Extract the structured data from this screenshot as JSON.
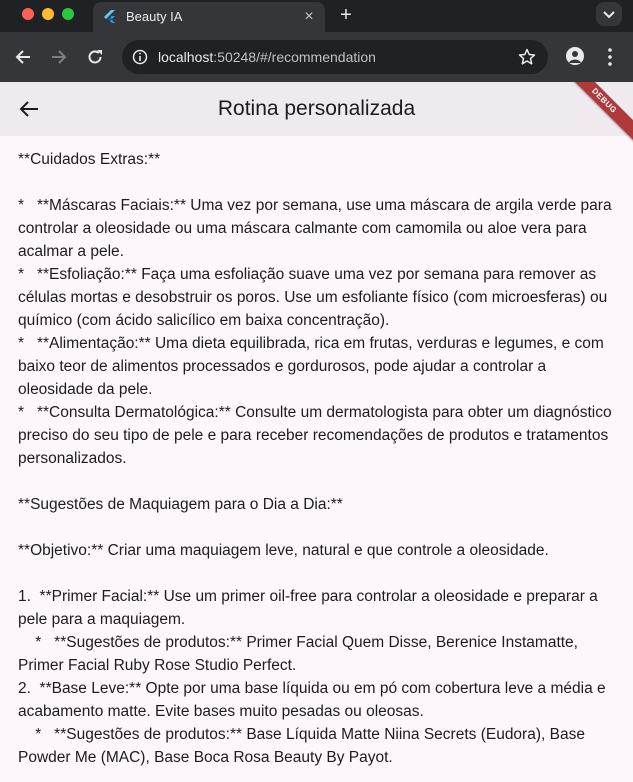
{
  "browser": {
    "tab_title": "Beauty IA",
    "tab_close": "×",
    "new_tab": "+",
    "url_host": "localhost",
    "url_rest": ":50248/#/recommendation"
  },
  "app": {
    "title": "Rotina personalizada",
    "debug_banner": "DEBUG"
  },
  "content": {
    "lines": [
      "**Cuidados Extras:**",
      "",
      "*   **Máscaras Faciais:** Uma vez por semana, use uma máscara de argila verde para controlar a oleosidade ou uma máscara calmante com camomila ou aloe vera para acalmar a pele.",
      "*   **Esfoliação:** Faça uma esfoliação suave uma vez por semana para remover as células mortas e desobstruir os poros. Use um esfoliante físico (com microesferas) ou químico (com ácido salicílico em baixa concentração).",
      "*   **Alimentação:** Uma dieta equilibrada, rica em frutas, verduras e legumes, e com baixo teor de alimentos processados e gordurosos, pode ajudar a controlar a oleosidade da pele.",
      "*   **Consulta Dermatológica:** Consulte um dermatologista para obter um diagnóstico preciso do seu tipo de pele e para receber recomendações de produtos e tratamentos personalizados.",
      "",
      "**Sugestões de Maquiagem para o Dia a Dia:**",
      "",
      "**Objetivo:** Criar uma maquiagem leve, natural e que controle a oleosidade.",
      "",
      "1.  **Primer Facial:** Use um primer oil-free para controlar a oleosidade e preparar a pele para a maquiagem.",
      "    *   **Sugestões de produtos:** Primer Facial Quem Disse, Berenice Instamatte, Primer Facial Ruby Rose Studio Perfect.",
      "2.  **Base Leve:** Opte por uma base líquida ou em pó com cobertura leve a média e acabamento matte. Evite bases muito pesadas ou oleosas.",
      "    *   **Sugestões de produtos:** Base Líquida Matte Niina Secrets (Eudora), Base Powder Me (MAC), Base Boca Rosa Beauty By Payot."
    ]
  }
}
